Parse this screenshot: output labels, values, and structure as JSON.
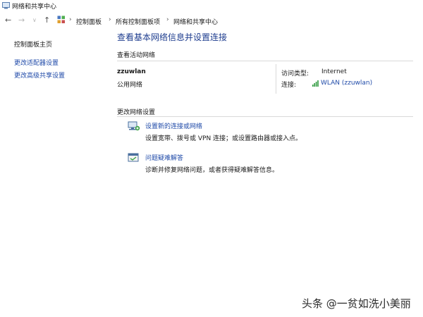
{
  "window": {
    "title": "网络和共享中心"
  },
  "breadcrumb": [
    "控制面板",
    "所有控制面板项",
    "网络和共享中心"
  ],
  "sidebar": {
    "home": "控制面板主页",
    "links": [
      "更改适配器设置",
      "更改高级共享设置"
    ]
  },
  "main": {
    "title": "查看基本网络信息并设置连接",
    "active_header": "查看活动网络",
    "network": {
      "name": "zzuwlan",
      "type": "公用网络",
      "access_type_label": "访问类型:",
      "access_type_value": "Internet",
      "connection_label": "连接:",
      "connection_value": "WLAN (zzuwlan)"
    },
    "change_header": "更改网络设置",
    "tasks": [
      {
        "label": "设置新的连接或网络",
        "desc": "设置宽带、拨号或 VPN 连接；或设置路由器或接入点。",
        "icon": "network-setup-icon"
      },
      {
        "label": "问题疑难解答",
        "desc": "诊断并修复网络问题，或者获得疑难解答信息。",
        "icon": "troubleshoot-icon"
      }
    ]
  },
  "watermark": "头条 @一贫如洗小美丽",
  "colors": {
    "link": "#1f4aa8",
    "title": "#1e3d8f",
    "wifi": "#2e9a3e"
  }
}
